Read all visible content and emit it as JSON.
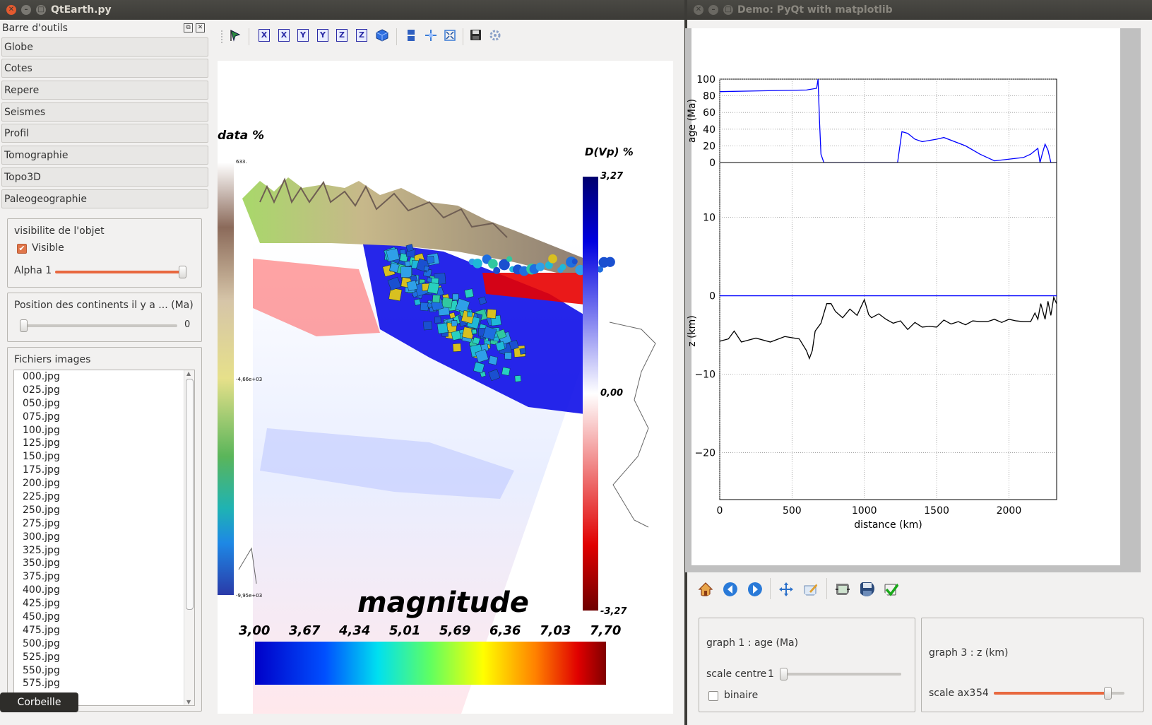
{
  "left_window": {
    "title": "QtEarth.py",
    "dock_title": "Barre d'outils",
    "toolbox_items": [
      "Globe",
      "Cotes",
      "Repere",
      "Seismes",
      "Profil",
      "Tomographie",
      "Topo3D",
      "Paleogeographie"
    ],
    "visibility_group": {
      "title": "visibilite de l'objet",
      "visible_label": "Visible",
      "visible_checked": true,
      "alpha_label": "Alpha 1",
      "alpha_value": 1.0
    },
    "continents_group": {
      "title": "Position des continents il y a ... (Ma)",
      "value": "0",
      "slider_fraction": 0.0
    },
    "images_group": {
      "title": "Fichiers images",
      "files": [
        "000.jpg",
        "025.jpg",
        "050.jpg",
        "075.jpg",
        "100.jpg",
        "125.jpg",
        "150.jpg",
        "175.jpg",
        "200.jpg",
        "225.jpg",
        "250.jpg",
        "275.jpg",
        "300.jpg",
        "325.jpg",
        "350.jpg",
        "375.jpg",
        "400.jpg",
        "425.jpg",
        "450.jpg",
        "475.jpg",
        "500.jpg",
        "525.jpg",
        "550.jpg",
        "575.jpg"
      ]
    },
    "tooltip": "Corbeille",
    "toolbar_icons": [
      "pointer-icon",
      "axis-x-icon",
      "axis-x-icon",
      "axis-y-icon",
      "axis-y-icon",
      "axis-z-icon",
      "axis-z-icon",
      "cube-icon",
      "layers-icon",
      "crosshair-icon",
      "fit-view-icon",
      "save-icon",
      "settings-icon"
    ],
    "toolbar_axis_letters": [
      "X",
      "X",
      "Y",
      "Y",
      "Z",
      "Z"
    ],
    "view3d": {
      "data_label": "data %",
      "data_ticks": [
        "633.",
        "-4,66e+03",
        "-9,95e+03"
      ],
      "dvp_label": "D(Vp) %",
      "dvp_ticks": [
        "3,27",
        "0,00",
        "-3,27"
      ],
      "magnitude_label": "magnitude",
      "magnitude_ticks": [
        "3,00",
        "3,67",
        "4,34",
        "5,01",
        "5,69",
        "6,36",
        "7,03",
        "7,70"
      ]
    }
  },
  "right_window": {
    "title": "Demo: PyQt with matplotlib",
    "chart_data": [
      {
        "type": "line",
        "ylabel": "age (Ma)",
        "xlim": [
          0,
          2330
        ],
        "ylim": [
          0,
          100
        ],
        "yticks": [
          "0",
          "20",
          "40",
          "60",
          "80",
          "100"
        ],
        "grid": true,
        "series": [
          {
            "color": "#0000ff",
            "x": [
              0,
              300,
              600,
              670,
              680,
              690,
              700,
              720,
              1200,
              1230,
              1260,
              1300,
              1350,
              1400,
              1500,
              1550,
              1700,
              1800,
              1900,
              2100,
              2150,
              2200,
              2215,
              2230,
              2250,
              2270,
              2290,
              2330
            ],
            "y": [
              85,
              86,
              87,
              89,
              100,
              50,
              10,
              0,
              0,
              0,
              37,
              35,
              28,
              25,
              28,
              30,
              20,
              10,
              2,
              6,
              10,
              17,
              0,
              10,
              22,
              15,
              0,
              0
            ]
          }
        ]
      },
      {
        "type": "line",
        "xlabel": "distance (km)",
        "ylabel": "z (km)",
        "xlim": [
          0,
          2330
        ],
        "ylim": [
          -26,
          17
        ],
        "xticks": [
          "0",
          "500",
          "1000",
          "1500",
          "2000"
        ],
        "yticks": [
          "−20",
          "−10",
          "0",
          "10"
        ],
        "grid": true,
        "series": [
          {
            "color": "#0000ff",
            "x": [
              0,
              2330
            ],
            "y": [
              0,
              0
            ]
          },
          {
            "color": "#000000",
            "x": [
              0,
              60,
              100,
              150,
              250,
              350,
              450,
              550,
              600,
              620,
              640,
              660,
              700,
              740,
              770,
              800,
              850,
              900,
              950,
              1000,
              1030,
              1050,
              1100,
              1150,
              1200,
              1250,
              1300,
              1350,
              1400,
              1450,
              1500,
              1550,
              1600,
              1650,
              1700,
              1750,
              1800,
              1850,
              1900,
              1950,
              2000,
              2050,
              2100,
              2150,
              2180,
              2200,
              2220,
              2250,
              2270,
              2290,
              2310,
              2330
            ],
            "y": [
              -5.8,
              -5.5,
              -4.5,
              -5.9,
              -5.4,
              -5.9,
              -5.2,
              -5.5,
              -7,
              -8,
              -7,
              -4.5,
              -3.5,
              -1,
              -1,
              -2,
              -2.8,
              -1.7,
              -2.5,
              -0.5,
              -2.4,
              -2.8,
              -2.3,
              -3,
              -3.5,
              -3.2,
              -4.3,
              -3.4,
              -4,
              -3.9,
              -4,
              -3.1,
              -3.6,
              -3.3,
              -3.7,
              -3.2,
              -3.3,
              -3.3,
              -3,
              -3.4,
              -3,
              -3.2,
              -3.3,
              -3.3,
              -2.2,
              -3,
              -1,
              -3,
              -0.7,
              -2.5,
              -0.2,
              -1
            ]
          }
        ]
      }
    ],
    "nav_icons": [
      "home-icon",
      "back-icon",
      "forward-icon",
      "pan-icon",
      "edit-axis-icon",
      "configure-subplots-icon",
      "save-icon",
      "check-icon"
    ],
    "graph1": {
      "title": "graph 1 : age (Ma)",
      "scale_label": "scale centre",
      "scale_value": "1",
      "scale_fraction": 0.0,
      "binaire_label": "binaire",
      "binaire_checked": false
    },
    "graph3": {
      "title": "graph 3 : z (km)",
      "scale_label": "scale ax3",
      "scale_value": "54",
      "scale_fraction": 0.9
    }
  }
}
